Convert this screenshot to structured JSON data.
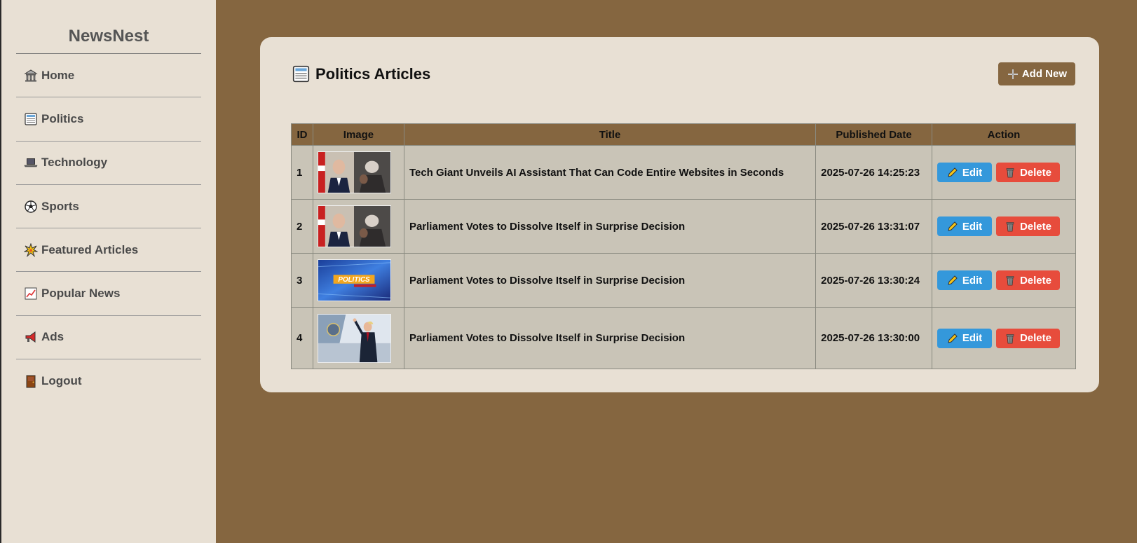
{
  "app": {
    "brand": "NewsNest"
  },
  "sidebar": {
    "items": [
      {
        "label": "Home",
        "icon": "bank-icon"
      },
      {
        "label": "Politics",
        "icon": "newspaper-icon"
      },
      {
        "label": "Technology",
        "icon": "laptop-icon"
      },
      {
        "label": "Sports",
        "icon": "soccer-ball-icon"
      },
      {
        "label": "Featured Articles",
        "icon": "sparkle-burst-icon"
      },
      {
        "label": "Popular News",
        "icon": "chart-up-icon"
      },
      {
        "label": "Ads",
        "icon": "megaphone-icon"
      },
      {
        "label": "Logout",
        "icon": "door-icon"
      }
    ]
  },
  "main": {
    "title": "Politics Articles",
    "title_icon": "newspaper-icon",
    "add_label": "Add New",
    "table": {
      "headers": [
        "ID",
        "Image",
        "Title",
        "Published Date",
        "Action"
      ],
      "rows": [
        {
          "id": "1",
          "title": "Tech Giant Unveils AI Assistant That Can Code Entire Websites in Seconds",
          "date": "2025-07-26 14:25:23",
          "image": "two-men-portrait-photo"
        },
        {
          "id": "2",
          "title": "Parliament Votes to Dissolve Itself in Surprise Decision",
          "date": "2025-07-26 13:31:07",
          "image": "two-men-portrait-photo"
        },
        {
          "id": "3",
          "title": "Parliament Votes to Dissolve Itself in Surprise Decision",
          "date": "2025-07-26 13:30:24",
          "image": "politics-banner-photo"
        },
        {
          "id": "4",
          "title": "Parliament Votes to Dissolve Itself in Surprise Decision",
          "date": "2025-07-26 13:30:00",
          "image": "man-waving-plane-photo"
        }
      ],
      "edit_label": "Edit",
      "delete_label": "Delete"
    },
    "thumb_overlay_text": "POLITICS"
  },
  "colors": {
    "page_bg": "#856640",
    "panel_bg": "#e8e0d4",
    "table_row_bg": "#c9c4b7",
    "edit_blue": "#3498db",
    "delete_red": "#e74c3c"
  }
}
